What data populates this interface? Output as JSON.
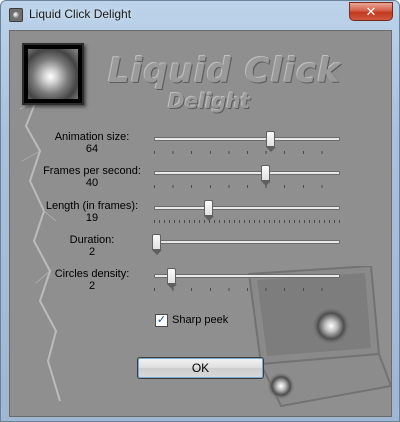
{
  "window": {
    "title": "Liquid Click Delight",
    "close_glyph": "✕"
  },
  "logo": {
    "main_text": "Liquid Click",
    "sub_text": "Delight",
    "image_icon": "liquid-drop-icon"
  },
  "params": [
    {
      "label": "Animation size:",
      "value": "64",
      "position": 0.62
    },
    {
      "label": "Frames per second:",
      "value": "40",
      "position": 0.59
    },
    {
      "label": "Length (in frames):",
      "value": "19",
      "position": 0.28
    },
    {
      "label": "Duration:",
      "value": "2",
      "position": 0.0
    },
    {
      "label": "Circles density:",
      "value": "2",
      "position": 0.08
    }
  ],
  "options": {
    "sharp_peek_label": "Sharp peek",
    "sharp_peek_checked": true,
    "check_glyph": "✓"
  },
  "buttons": {
    "ok_label": "OK"
  },
  "colors": {
    "client_bg": "#8f8f8f",
    "frame_blue": "#a9c1dc",
    "close_red": "#c1391f"
  }
}
